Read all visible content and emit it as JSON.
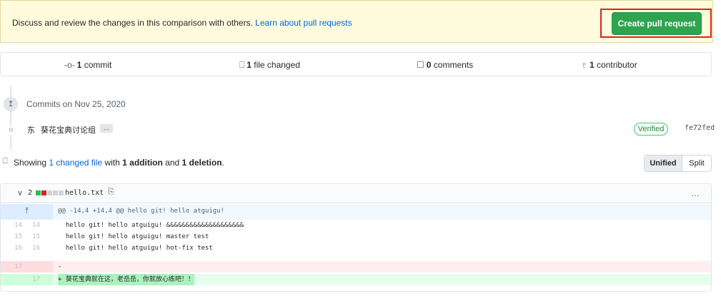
{
  "banner": {
    "text": "Discuss and review the changes in this comparison with others.",
    "link": "Learn about pull requests",
    "button": "Create pull request"
  },
  "summary": {
    "commits": {
      "icon": "git-commit-icon",
      "count": "1",
      "label": "commit"
    },
    "files": {
      "icon": "file-diff-icon",
      "count": "1",
      "label": "file changed"
    },
    "comments": {
      "icon": "comment-icon",
      "count": "0",
      "label": "comments"
    },
    "contributors": {
      "icon": "people-icon",
      "count": "1",
      "label": "contributor"
    }
  },
  "commits": {
    "heading": "Commits on Nov 25, 2020",
    "items": [
      {
        "avatar_text": "东",
        "message": "葵花宝典讨论组",
        "ellipsis": "…",
        "badge": "Verified",
        "sha": "fe72fed"
      }
    ]
  },
  "showing": {
    "prefix": "Showing",
    "link": "1 changed file",
    "mid": "with",
    "additions": "1 addition",
    "and": "and",
    "deletions": "1 deletion",
    "end": ".",
    "view_unified": "Unified",
    "view_split": "Split"
  },
  "file": {
    "change_count": "2",
    "filename": "hello.txt",
    "diffstat": [
      "added",
      "removed",
      "neutral",
      "neutral",
      "neutral"
    ],
    "colors": {
      "added": "#2cbe4e",
      "removed": "#cb2431",
      "neutral": "#d1d5da"
    },
    "hunk_header": "@@ -14,4 +14,4 @@ hello git! hello atguigu!",
    "lines": [
      {
        "type": "context",
        "old": "14",
        "new": "14",
        "text": "  hello git! hello atguigu! &&&&&&&&&&&&&&&&&&&&"
      },
      {
        "type": "context",
        "old": "15",
        "new": "15",
        "text": "  hello git! hello atguigu! master test"
      },
      {
        "type": "context",
        "old": "16",
        "new": "16",
        "text": "  hello git! hello atguigu! hot-fix test"
      },
      {
        "type": "del",
        "old": "17",
        "new": "",
        "text": "-"
      },
      {
        "type": "add",
        "old": "",
        "new": "17",
        "text": "+ 葵花宝典就在这，老岳岳，你就放心练吧！！"
      }
    ]
  }
}
